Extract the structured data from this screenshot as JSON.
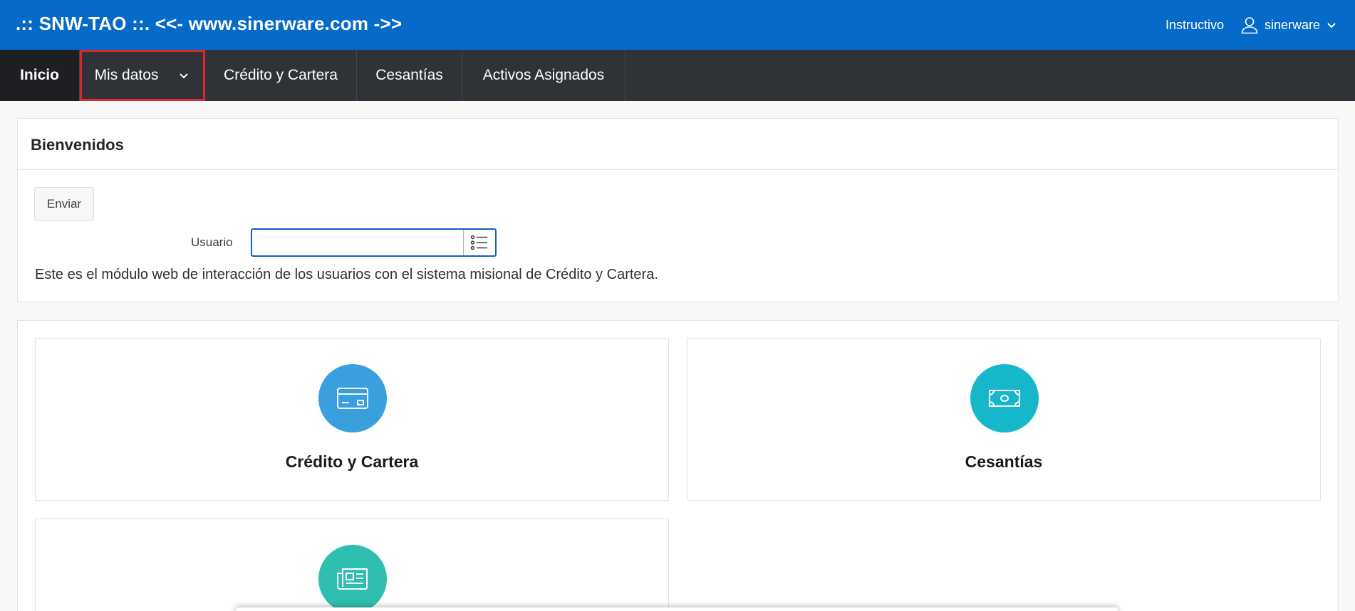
{
  "header": {
    "brand": ".:: SNW-TAO ::. <<- www.sinerware.com ->>",
    "help_link": "Instructivo",
    "username": "sinerware",
    "bg_color": "#056ac8"
  },
  "nav": {
    "items": [
      {
        "label": "Inicio"
      },
      {
        "label": "Mis datos"
      },
      {
        "label": "Crédito y Cartera"
      },
      {
        "label": "Cesantías"
      },
      {
        "label": "Activos Asignados"
      }
    ]
  },
  "welcome": {
    "title": "Bienvenidos",
    "button_label": "Enviar",
    "field_label": "Usuario",
    "field_value": "",
    "description": "Este es el módulo web de interacción de los usuarios con el sistema misional de Crédito y Cartera."
  },
  "tiles": [
    {
      "label": "Crédito y Cartera",
      "icon": "credit-card-icon",
      "color": "#3a9fdd"
    },
    {
      "label": "Cesantías",
      "icon": "money-icon",
      "color": "#17b7cb"
    },
    {
      "label": "",
      "icon": "newspaper-icon",
      "color": "#2ebfb0"
    }
  ]
}
